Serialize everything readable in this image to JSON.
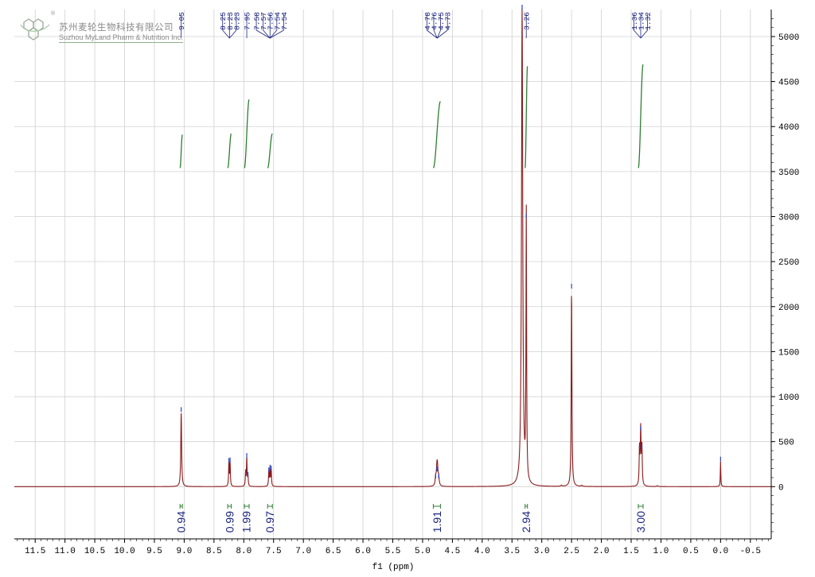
{
  "chart_data": {
    "type": "line",
    "xlabel": "f1 (ppm)",
    "x_ticks": [
      "11.5",
      "11.0",
      "10.5",
      "10.0",
      "9.5",
      "9.0",
      "8.5",
      "8.0",
      "7.5",
      "7.0",
      "6.5",
      "6.0",
      "5.5",
      "5.0",
      "4.5",
      "4.0",
      "3.5",
      "3.0",
      "2.5",
      "2.0",
      "1.5",
      "1.0",
      "0.5",
      "0.0",
      "-0.5"
    ],
    "y_ticks": [
      "5000",
      "4500",
      "4000",
      "3500",
      "3000",
      "2500",
      "2000",
      "1500",
      "1000",
      "500",
      "0"
    ],
    "xlim": [
      11.85,
      -0.85
    ],
    "ylim": [
      -580,
      5300
    ],
    "x_reversed": true,
    "grid": true,
    "series": [
      {
        "peaks": [
          {
            "ppm": 9.05,
            "height": 830,
            "width": 0.008
          },
          {
            "ppm": 8.25,
            "height": 265,
            "width": 0.006
          },
          {
            "ppm": 8.23,
            "height": 270,
            "width": 0.006
          },
          {
            "ppm": 7.97,
            "height": 140,
            "width": 0.006
          },
          {
            "ppm": 7.95,
            "height": 320,
            "width": 0.006
          },
          {
            "ppm": 7.93,
            "height": 110,
            "width": 0.006
          },
          {
            "ppm": 7.58,
            "height": 160,
            "width": 0.006
          },
          {
            "ppm": 7.56,
            "height": 190,
            "width": 0.006
          },
          {
            "ppm": 7.54,
            "height": 180,
            "width": 0.006
          },
          {
            "ppm": 4.78,
            "height": 90,
            "width": 0.01
          },
          {
            "ppm": 4.76,
            "height": 170,
            "width": 0.01
          },
          {
            "ppm": 4.75,
            "height": 170,
            "width": 0.01
          },
          {
            "ppm": 4.73,
            "height": 90,
            "width": 0.01
          },
          {
            "ppm": 3.33,
            "height": 5400,
            "width": 0.012
          },
          {
            "ppm": 3.26,
            "height": 2980,
            "width": 0.006
          },
          {
            "ppm": 2.5,
            "height": 2200,
            "width": 0.007
          },
          {
            "ppm": 1.36,
            "height": 420,
            "width": 0.007
          },
          {
            "ppm": 1.34,
            "height": 620,
            "width": 0.007
          },
          {
            "ppm": 1.32,
            "height": 420,
            "width": 0.007
          },
          {
            "ppm": 0.0,
            "height": 280,
            "width": 0.005
          },
          {
            "ppm": 2.67,
            "height": 12,
            "width": 0.01
          },
          {
            "ppm": 2.33,
            "height": 12,
            "width": 0.01
          },
          {
            "ppm": 1.06,
            "height": 10,
            "width": 0.01
          }
        ]
      }
    ],
    "peak_labels": [
      {
        "anchor": 9.05,
        "values": [
          "9.05"
        ]
      },
      {
        "anchor": 8.24,
        "values": [
          "8.25",
          "8.23",
          "8.23"
        ]
      },
      {
        "anchor": 7.95,
        "values": [
          "7.95"
        ]
      },
      {
        "anchor": 7.56,
        "values": [
          "7.58",
          "7.57",
          "7.56",
          "7.54",
          "7.54"
        ]
      },
      {
        "anchor": 4.755,
        "values": [
          "4.78",
          "4.76",
          "4.75",
          "4.73"
        ]
      },
      {
        "anchor": 3.26,
        "values": [
          "3.26"
        ]
      },
      {
        "anchor": 1.34,
        "values": [
          "1.36",
          "1.34",
          "1.32"
        ]
      }
    ],
    "integrals": [
      {
        "center": 9.05,
        "from": 9.07,
        "to": 9.03,
        "value": "0.94"
      },
      {
        "center": 8.24,
        "from": 8.27,
        "to": 8.21,
        "value": "0.99"
      },
      {
        "center": 7.96,
        "from": 7.99,
        "to": 7.91,
        "value": "1.99"
      },
      {
        "center": 7.56,
        "from": 7.6,
        "to": 7.52,
        "value": "0.97"
      },
      {
        "center": 4.76,
        "from": 4.82,
        "to": 4.7,
        "value": "1.91"
      },
      {
        "center": 3.26,
        "from": 3.28,
        "to": 3.24,
        "value": "2.94"
      },
      {
        "center": 1.34,
        "from": 1.38,
        "to": 1.3,
        "value": "3.00"
      }
    ],
    "integral_curves": [
      {
        "from": 9.07,
        "to": 9.03,
        "start": 3540,
        "end": 3910
      },
      {
        "from": 8.27,
        "to": 8.21,
        "start": 3540,
        "end": 3920
      },
      {
        "from": 7.99,
        "to": 7.91,
        "start": 3540,
        "end": 4300
      },
      {
        "from": 7.6,
        "to": 7.52,
        "start": 3540,
        "end": 3920
      },
      {
        "from": 4.82,
        "to": 4.7,
        "start": 3540,
        "end": 4280
      },
      {
        "from": 3.28,
        "to": 3.24,
        "start": 3540,
        "end": 4670
      },
      {
        "from": 1.38,
        "to": 1.3,
        "start": 3540,
        "end": 4690
      }
    ],
    "colors": {
      "spectrum": "#8b1a1a",
      "integral_curve": "#2e7d32",
      "label_text": "#1a237e",
      "integral_value": "#1a237e",
      "peak_marker": "#3040c0",
      "grid": "#d0d0d0",
      "axis": "#000000"
    }
  },
  "logo": {
    "company_cn": "苏州麦轮生物科技有限公司",
    "company_en": "Suzhou MyLand Pharm & Nutrition Inc.",
    "registered": "®"
  }
}
